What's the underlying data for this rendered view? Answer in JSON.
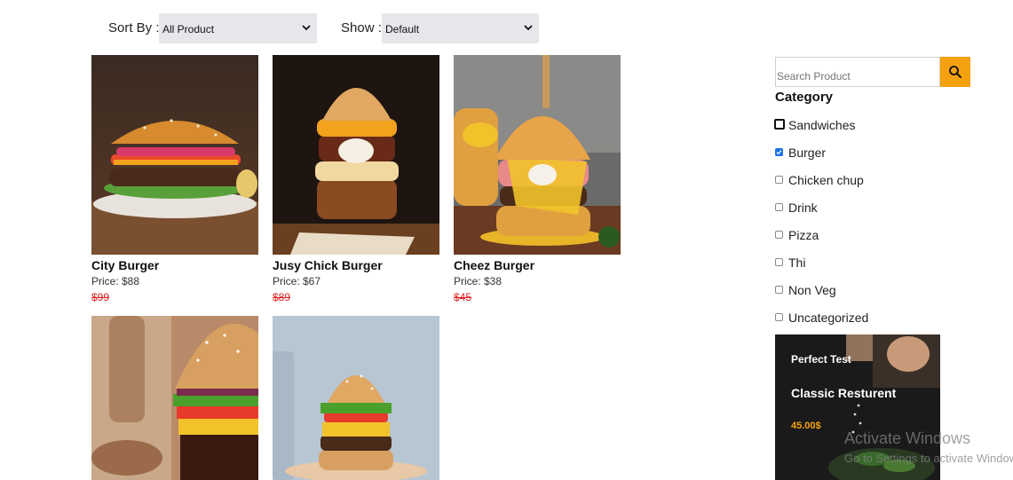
{
  "toolbar": {
    "sort_label": "Sort By :",
    "sort_value": "All Product",
    "show_label": "Show :",
    "show_value": "Default"
  },
  "products": [
    {
      "name": "City Burger",
      "price": "Price: $88",
      "old_price": "$99"
    },
    {
      "name": "Jusy Chick Burger",
      "price": "Price: $67",
      "old_price": "$89"
    },
    {
      "name": "Cheez Burger",
      "price": "Price: $38",
      "old_price": "$45"
    },
    {
      "name": "",
      "price": "",
      "old_price": ""
    },
    {
      "name": "",
      "price": "",
      "old_price": ""
    }
  ],
  "sidebar": {
    "search_placeholder": "Search Product",
    "search_icon": "search-icon",
    "category_title": "Category",
    "categories": [
      {
        "label": "Sandwiches",
        "checked": false,
        "focused": true
      },
      {
        "label": "Burger",
        "checked": true,
        "focused": false
      },
      {
        "label": "Chicken chup",
        "checked": false,
        "focused": false
      },
      {
        "label": "Drink",
        "checked": false,
        "focused": false
      },
      {
        "label": "Pizza",
        "checked": false,
        "focused": false
      },
      {
        "label": "Thi",
        "checked": false,
        "focused": false
      },
      {
        "label": "Non Veg",
        "checked": false,
        "focused": false
      },
      {
        "label": "Uncategorized",
        "checked": false,
        "focused": false
      }
    ],
    "promo": {
      "tagline": "Perfect Test",
      "title": "Classic Resturent",
      "price": "45.00$"
    }
  },
  "watermark": {
    "line1": "Activate Windows",
    "line2": "Go to Settings to activate Windows."
  },
  "colors": {
    "accent": "#f5a10e",
    "strike_price": "#dd2222",
    "checkbox_checked": "#1a73e8",
    "select_bg": "#e6e7ea"
  }
}
